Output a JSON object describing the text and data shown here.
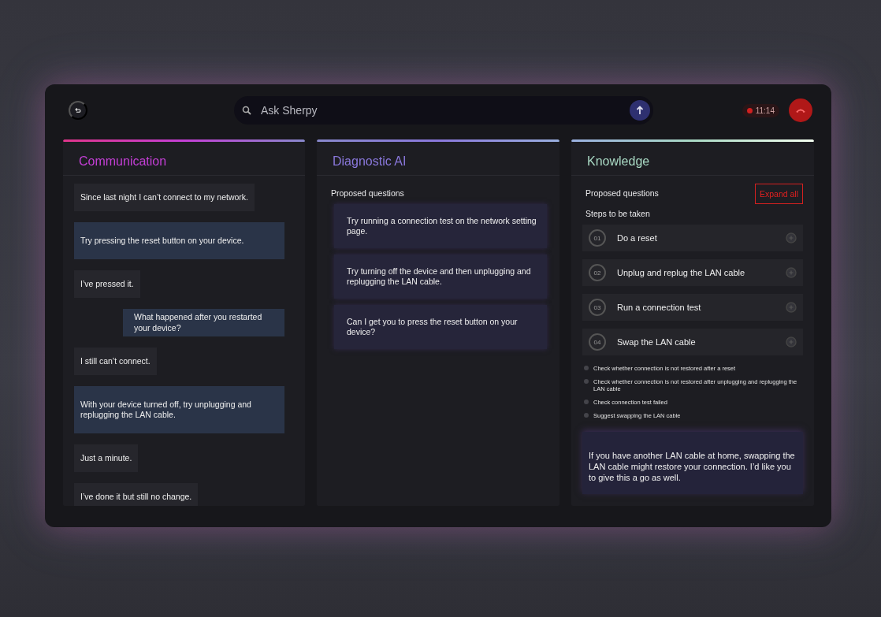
{
  "header": {
    "search": {
      "placeholder": "Ask Sherpy"
    },
    "timer": "11:14"
  },
  "communication": {
    "title": "Communication",
    "color": "#c43fd6",
    "messages": [
      {
        "kind": "customer",
        "text": "Since last night I can’t connect to my network."
      },
      {
        "kind": "agent",
        "text": "Try pressing the reset button on your device."
      },
      {
        "kind": "customer",
        "text": "I’ve pressed it."
      },
      {
        "kind": "agent_right",
        "text": "What happened after you restarted your device?"
      },
      {
        "kind": "customer",
        "text": "I still can’t connect."
      },
      {
        "kind": "agent",
        "text": "With your device turned off, try unplugging and replugging the LAN cable."
      },
      {
        "kind": "customer",
        "text": "Just a minute."
      },
      {
        "kind": "customer",
        "text": "I’ve done it but still no change."
      }
    ]
  },
  "diagnostic": {
    "title": "Diagnostic AI",
    "color": "#8a78dc",
    "subtitle": "Proposed questions",
    "questions": [
      "Try running a connection test on the network setting page.",
      "Try turning off the device and then unplugging and replugging the LAN cable.",
      "Can I get you to press the reset button on your device?"
    ]
  },
  "knowledge": {
    "title": "Knowledge",
    "color": "#a9d9c4",
    "subtitle": "Proposed questions",
    "expand_button": "Expand all",
    "steps_label": "Steps to be taken",
    "steps": [
      {
        "number": "01",
        "label": "Do a reset"
      },
      {
        "number": "02",
        "label": "Unplug and replug the LAN cable"
      },
      {
        "number": "03",
        "label": "Run a connection test"
      },
      {
        "number": "04",
        "label": "Swap the LAN cable"
      }
    ],
    "checklist": [
      {
        "text": "Check whether connection is not restored after a reset",
        "checked": false
      },
      {
        "text": "Check whether connection is not restored after unplugging and replugging the LAN cable",
        "checked": false
      },
      {
        "text": "Check connection test failed",
        "checked": false
      },
      {
        "text": "Suggest swapping the LAN cable",
        "checked": false
      }
    ],
    "suggestion": "If you have another LAN cable at home, swapping the LAN cable might restore your connection. I’d like you to give this a go as well."
  }
}
